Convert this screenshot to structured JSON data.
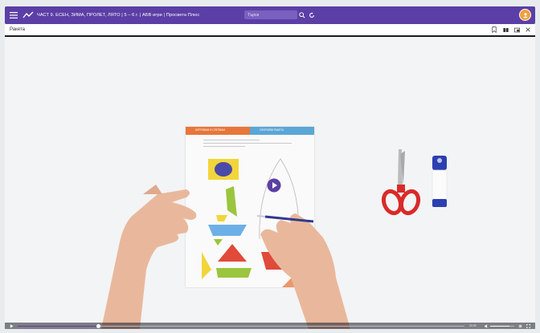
{
  "app": {
    "title": "ЧАСТ 9. ЕСЕН, ЗИМА, ПРОЛЕТ, ЛЯТО | 5 – 6 г. | АБВ игри | Просвета Плюс",
    "search_placeholder": "Търси"
  },
  "lesson": {
    "title": "Ракета"
  },
  "worksheet": {
    "left_header": "ИЗРЯЗВАМ И СЛЕПВАМ",
    "right_header": "ОФОРМЯМ РАКЕТА"
  },
  "player": {
    "time": "00:08",
    "progress": 0.18,
    "volume": 0.8
  },
  "colors": {
    "brand_purple": "#5b3fa6",
    "header_orange": "#e8763a",
    "header_blue": "#5ba6d6"
  },
  "icons": [
    "menu-icon",
    "logo-icon",
    "search-icon",
    "refresh-icon",
    "user-avatar-icon",
    "bookmark-icon",
    "book-icon",
    "window-icon",
    "close-icon",
    "play-icon",
    "volume-icon",
    "settings-icon",
    "fullscreen-icon"
  ]
}
